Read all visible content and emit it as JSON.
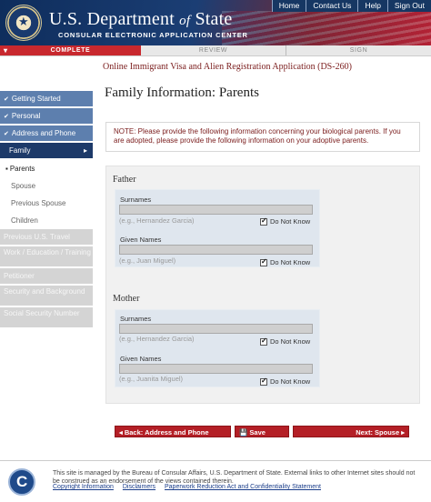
{
  "header": {
    "title_main": "U.S. Department ",
    "title_of": "of",
    "title_end": " State",
    "subtitle": "CONSULAR ELECTRONIC APPLICATION CENTER",
    "links": [
      "Home",
      "Contact Us",
      "Help",
      "Sign Out"
    ]
  },
  "progress": {
    "complete": "COMPLETE",
    "review": "REVIEW",
    "sign": "SIGN"
  },
  "app_title": "Online Immigrant Visa and Alien Registration Application (DS-260)",
  "sidebar": {
    "done_items": [
      "Getting Started",
      "Personal",
      "Address and Phone"
    ],
    "active": "Family",
    "sub_items": [
      "Parents",
      "Spouse",
      "Previous Spouse",
      "Children"
    ],
    "disabled_items": [
      "Previous U.S. Travel",
      "Work / Education / Training",
      "Petitioner",
      "Security and Background",
      "Social Security Number"
    ]
  },
  "main": {
    "title": "Family Information: Parents",
    "note": "NOTE: Please provide the following information concerning your biological parents. If you are adopted, please provide the following information on your adoptive parents.",
    "father": {
      "heading": "Father",
      "surnames_label": "Surnames",
      "surnames_value": "",
      "surnames_hint": "(e.g., Hernandez Garcia)",
      "given_label": "Given Names",
      "given_value": "",
      "given_hint": "(e.g., Juan Miguel)",
      "dnk_label": "Do Not Know",
      "surnames_dnk": true,
      "given_dnk": true
    },
    "mother": {
      "heading": "Mother",
      "surnames_label": "Surnames",
      "surnames_value": "",
      "surnames_hint": "(e.g., Hernandez Garcia)",
      "given_label": "Given Names",
      "given_value": "",
      "given_hint": "(e.g., Juanita Miguel)",
      "dnk_label": "Do Not Know",
      "surnames_dnk": true,
      "given_dnk": true
    }
  },
  "buttons": {
    "back": "◂ Back: Address and Phone",
    "save": "💾 Save",
    "next": "Next: Spouse ▸"
  },
  "footer": {
    "text": "This site is managed by the Bureau of Consular Affairs, U.S. Department of State. External links to other Internet sites should not be construed as an endorsement of the views contained therein.",
    "links": [
      "Copyright Information",
      "Disclaimers",
      "Paperwork Reduction Act and Confidentiality Statement"
    ]
  },
  "colors": {
    "accent_red": "#b41f26",
    "nav_blue": "#5d7fae",
    "nav_active": "#1d3a69"
  }
}
